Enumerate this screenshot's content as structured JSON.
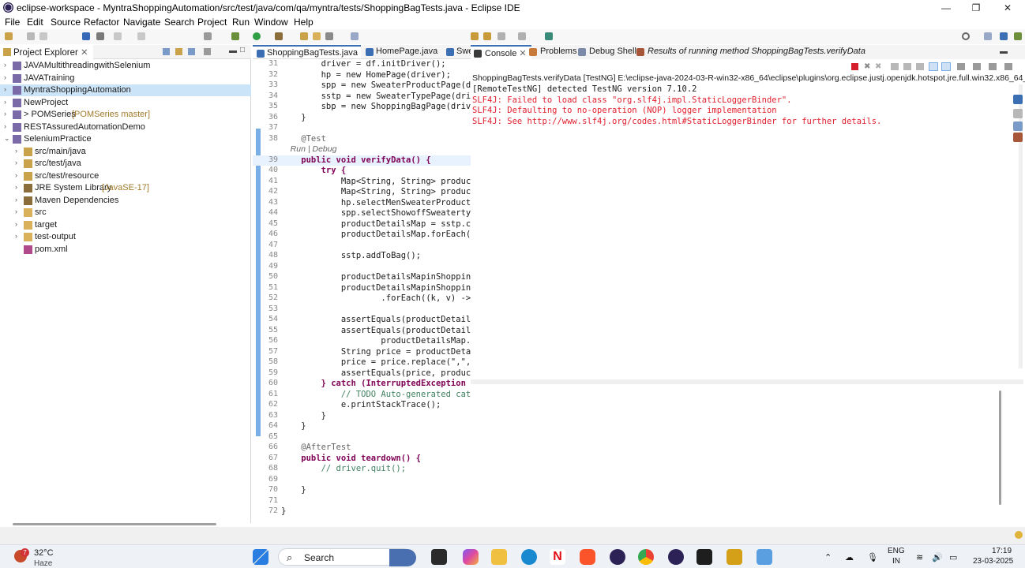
{
  "window": {
    "title": "eclipse-workspace - MyntraShoppingAutomation/src/test/java/com/qa/myntra/tests/ShoppingBagTests.java - Eclipse IDE",
    "minimize": "—",
    "maximize": "❐",
    "close": "✕"
  },
  "menu": [
    "File",
    "Edit",
    "Source",
    "Refactor",
    "Navigate",
    "Search",
    "Project",
    "Run",
    "Window",
    "Help"
  ],
  "explorer": {
    "tab_label": "Project Explorer",
    "items": [
      {
        "label": "JAVAMultithreadingwithSelenium",
        "extra": ""
      },
      {
        "label": "JAVATraining",
        "extra": ""
      },
      {
        "label": "MyntraShoppingAutomation",
        "extra": ""
      },
      {
        "label": "NewProject",
        "extra": ""
      },
      {
        "label": "> POMSeries",
        "extra": "[POMSeries master]"
      },
      {
        "label": "RESTAssuredAutomationDemo",
        "extra": ""
      },
      {
        "label": "SeleniumPractice",
        "extra": ""
      },
      {
        "label": "src/main/java",
        "extra": ""
      },
      {
        "label": "src/test/java",
        "extra": ""
      },
      {
        "label": "src/test/resource",
        "extra": ""
      },
      {
        "label": "JRE System Library",
        "extra": "[JavaSE-17]"
      },
      {
        "label": "Maven Dependencies",
        "extra": ""
      },
      {
        "label": "src",
        "extra": ""
      },
      {
        "label": "target",
        "extra": ""
      },
      {
        "label": "test-output",
        "extra": ""
      },
      {
        "label": "pom.xml",
        "extra": ""
      }
    ]
  },
  "editor": {
    "tabs": [
      "ShoppingBagTests.java",
      "HomePage.java",
      "Swe"
    ],
    "lines": [
      {
        "n": "31",
        "t": "        driver = df.initDriver();"
      },
      {
        "n": "32",
        "t": "        hp = new HomePage(driver);"
      },
      {
        "n": "33",
        "t": "        spp = new SweaterProductPage(dri"
      },
      {
        "n": "34",
        "t": "        sstp = new SweaterTypePage(drive"
      },
      {
        "n": "35",
        "t": "        sbp = new ShoppingBagPage(driver"
      },
      {
        "n": "36",
        "t": "    }"
      },
      {
        "n": "37",
        "t": ""
      },
      {
        "n": "38",
        "t": "    @Test"
      },
      {
        "n": "",
        "t": "    Run | Debug"
      },
      {
        "n": "39",
        "t": "    public void verifyData() {"
      },
      {
        "n": "40",
        "t": "        try {"
      },
      {
        "n": "41",
        "t": "            Map<String, String> productD"
      },
      {
        "n": "42",
        "t": "            Map<String, String> productD"
      },
      {
        "n": "43",
        "t": "            hp.selectMenSweaterProduct()"
      },
      {
        "n": "44",
        "t": "            spp.selectShowoffSweatertype"
      },
      {
        "n": "45",
        "t": "            productDetailsMap = sstp.cap"
      },
      {
        "n": "46",
        "t": "            productDetailsMap.forEach((k"
      },
      {
        "n": "47",
        "t": ""
      },
      {
        "n": "48",
        "t": "            sstp.addToBag();"
      },
      {
        "n": "49",
        "t": ""
      },
      {
        "n": "50",
        "t": "            productDetailsMapinShoppingB"
      },
      {
        "n": "51",
        "t": "            productDetailsMapinShoppingB"
      },
      {
        "n": "52",
        "t": "                    .forEach((k, v) -> S"
      },
      {
        "n": "53",
        "t": ""
      },
      {
        "n": "54",
        "t": "            assertEquals(productDetailsM"
      },
      {
        "n": "55",
        "t": "            assertEquals(productDetailsM"
      },
      {
        "n": "56",
        "t": "                    productDetailsMap.ge"
      },
      {
        "n": "57",
        "t": "            String price = productDetail"
      },
      {
        "n": "58",
        "t": "            price = price.replace(\",\", \""
      },
      {
        "n": "59",
        "t": "            assertEquals(price, productD"
      },
      {
        "n": "60",
        "t": "        } catch (InterruptedException e)"
      },
      {
        "n": "61",
        "t": "            // TODO Auto-generated catch block"
      },
      {
        "n": "62",
        "t": "            e.printStackTrace();"
      },
      {
        "n": "63",
        "t": "        }"
      },
      {
        "n": "64",
        "t": "    }"
      },
      {
        "n": "65",
        "t": ""
      },
      {
        "n": "66",
        "t": "    @AfterTest"
      },
      {
        "n": "67",
        "t": "    public void teardown() {"
      },
      {
        "n": "68",
        "t": "        // driver.quit();"
      },
      {
        "n": "69",
        "t": ""
      },
      {
        "n": "70",
        "t": "    }"
      },
      {
        "n": "71",
        "t": ""
      },
      {
        "n": "72",
        "t": "}"
      }
    ]
  },
  "console": {
    "tabs": [
      "Console",
      "Problems",
      "Debug Shell",
      "Results of running method ShoppingBagTests.verifyData"
    ],
    "launch": "ShoppingBagTests.verifyData [TestNG] E:\\eclipse-java-2024-03-R-win32-x86_64\\eclipse\\plugins\\org.eclipse.justj.openjdk.hotspot.jre.full.win32.x86_64_17.0",
    "lines": [
      {
        "text": "[RemoteTestNG] detected TestNG version 7.10.2",
        "error": false
      },
      {
        "text": "SLF4J: Failed to load class \"org.slf4j.impl.StaticLoggerBinder\".",
        "error": true
      },
      {
        "text": "SLF4J: Defaulting to no-operation (NOP) logger implementation",
        "error": true
      },
      {
        "text": "SLF4J: See http://www.slf4j.org/codes.html#StaticLoggerBinder for further details.",
        "error": true
      }
    ]
  },
  "taskbar": {
    "weather_temp": "32°C",
    "weather_desc": "Haze",
    "weather_badge": "7",
    "search_placeholder": "Search",
    "lang_top": "ENG",
    "lang_bottom": "IN",
    "time": "17:19",
    "date": "23-03-2025"
  }
}
